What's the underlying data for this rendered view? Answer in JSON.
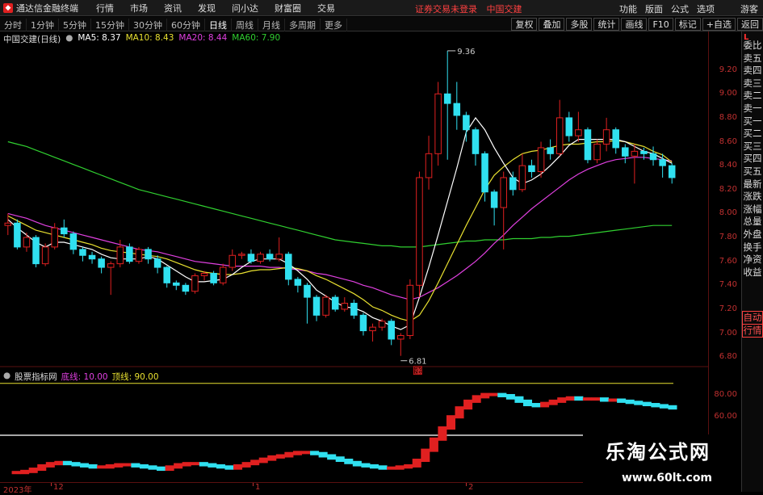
{
  "app": {
    "logo_text": "通达信金融终端",
    "menus": [
      "行情",
      "市场",
      "资讯",
      "发现",
      "问小达",
      "财富圈",
      "交易"
    ],
    "warning": "证券交易未登录",
    "stock_name": "中国交建",
    "right_menus": [
      "功能",
      "版面",
      "公式",
      "选项",
      "游客"
    ]
  },
  "toolbar": {
    "periods": [
      "分时",
      "1分钟",
      "5分钟",
      "15分钟",
      "30分钟",
      "60分钟",
      "日线",
      "周线",
      "月线",
      "多周期",
      "更多"
    ],
    "active_period": "日线",
    "buttons": [
      "复权",
      "叠加",
      "多股",
      "统计",
      "画线",
      "F10",
      "标记",
      "+自选",
      "返回"
    ]
  },
  "main_header": {
    "title": "中国交建(日线)",
    "ma5": "MA5: 8.37",
    "ma10": "MA10: 8.43",
    "ma20": "MA20: 8.44",
    "ma60": "MA60: 7.90",
    "colors": {
      "ma5": "#ffffff",
      "ma10": "#e8e030",
      "ma20": "#e040e0",
      "ma60": "#30d030"
    }
  },
  "sub_header": {
    "title": "股票指标网",
    "line1": "底线: 10.00",
    "line2": "顶线: 90.00",
    "colors": {
      "line1": "#e040e0",
      "line2": "#e8e030"
    }
  },
  "side_panel": {
    "corner": "L",
    "items": [
      "委比",
      "卖五",
      "卖四",
      "卖三",
      "卖二",
      "卖一",
      "买一",
      "买二",
      "买三",
      "买四",
      "买五",
      "最新",
      "涨跌",
      "涨幅",
      "总量",
      "外盘",
      "换手",
      "净资",
      "收益"
    ],
    "boxed_items": [
      "自动",
      "行情"
    ]
  },
  "chart_data": [
    {
      "type": "candlestick",
      "title": "中国交建(日线)",
      "ylim": [
        6.7,
        9.4
      ],
      "yticks": [
        "9.20",
        "9.00",
        "8.80",
        "8.60",
        "8.40",
        "8.20",
        "8.00",
        "7.80",
        "7.60",
        "7.40",
        "7.20",
        "7.00",
        "6.80"
      ],
      "annotations": {
        "high": "9.36",
        "low": "6.81",
        "marker": "涨"
      },
      "colors": {
        "up": "#e02020",
        "down": "#30e0f0"
      },
      "candles": [
        [
          7.9,
          7.92,
          8.0,
          7.82
        ],
        [
          7.92,
          7.72,
          7.95,
          7.7
        ],
        [
          7.72,
          7.8,
          7.84,
          7.68
        ],
        [
          7.8,
          7.58,
          7.82,
          7.55
        ],
        [
          7.58,
          7.72,
          7.75,
          7.56
        ],
        [
          7.72,
          7.88,
          7.92,
          7.7
        ],
        [
          7.88,
          7.83,
          7.95,
          7.8
        ],
        [
          7.83,
          7.7,
          7.85,
          7.66
        ],
        [
          7.7,
          7.65,
          7.72,
          7.6
        ],
        [
          7.65,
          7.62,
          7.68,
          7.58
        ],
        [
          7.62,
          7.55,
          7.64,
          7.5
        ],
        [
          7.55,
          7.58,
          7.6,
          7.32
        ],
        [
          7.58,
          7.72,
          7.78,
          7.55
        ],
        [
          7.72,
          7.6,
          7.75,
          7.58
        ],
        [
          7.6,
          7.7,
          7.72,
          7.58
        ],
        [
          7.7,
          7.62,
          7.72,
          7.58
        ],
        [
          7.62,
          7.55,
          7.65,
          7.5
        ],
        [
          7.55,
          7.42,
          7.56,
          7.38
        ],
        [
          7.42,
          7.4,
          7.44,
          7.36
        ],
        [
          7.4,
          7.35,
          7.42,
          7.32
        ],
        [
          7.35,
          7.48,
          7.5,
          7.33
        ],
        [
          7.48,
          7.5,
          7.52,
          7.44
        ],
        [
          7.5,
          7.42,
          7.52,
          7.4
        ],
        [
          7.42,
          7.55,
          7.58,
          7.4
        ],
        [
          7.55,
          7.65,
          7.7,
          7.52
        ],
        [
          7.65,
          7.66,
          7.68,
          7.62
        ],
        [
          7.66,
          7.6,
          7.7,
          7.58
        ],
        [
          7.6,
          7.66,
          7.68,
          7.58
        ],
        [
          7.66,
          7.62,
          7.7,
          7.6
        ],
        [
          7.62,
          7.66,
          7.8,
          7.6
        ],
        [
          7.66,
          7.45,
          7.68,
          7.4
        ],
        [
          7.45,
          7.4,
          7.47,
          7.34
        ],
        [
          7.4,
          7.3,
          7.42,
          7.08
        ],
        [
          7.3,
          7.15,
          7.32,
          7.1
        ],
        [
          7.15,
          7.3,
          7.32,
          7.13
        ],
        [
          7.3,
          7.2,
          7.32,
          7.18
        ],
        [
          7.2,
          7.25,
          7.3,
          7.18
        ],
        [
          7.25,
          7.15,
          7.28,
          7.12
        ],
        [
          7.15,
          7.02,
          7.17,
          6.98
        ],
        [
          7.02,
          7.05,
          7.08,
          6.93
        ],
        [
          7.05,
          7.1,
          7.12,
          7.02
        ],
        [
          7.1,
          6.95,
          7.12,
          6.9
        ],
        [
          6.95,
          6.98,
          7.0,
          6.81
        ],
        [
          6.98,
          7.4,
          7.45,
          6.95
        ],
        [
          7.4,
          8.3,
          8.35,
          7.3
        ],
        [
          8.3,
          8.5,
          8.65,
          8.2
        ],
        [
          8.5,
          9.0,
          9.1,
          8.4
        ],
        [
          9.0,
          8.92,
          9.36,
          8.45
        ],
        [
          8.92,
          8.82,
          9.1,
          8.7
        ],
        [
          8.82,
          8.7,
          8.85,
          8.6
        ],
        [
          8.7,
          8.5,
          8.72,
          8.4
        ],
        [
          8.5,
          8.18,
          8.52,
          8.1
        ],
        [
          8.18,
          8.05,
          8.2,
          7.9
        ],
        [
          8.05,
          8.3,
          8.35,
          7.7
        ],
        [
          8.3,
          8.2,
          8.35,
          8.15
        ],
        [
          8.2,
          8.4,
          8.5,
          8.18
        ],
        [
          8.4,
          8.35,
          8.45,
          8.3
        ],
        [
          8.35,
          8.55,
          8.6,
          8.3
        ],
        [
          8.55,
          8.5,
          8.62,
          8.45
        ],
        [
          8.5,
          8.8,
          8.95,
          8.48
        ],
        [
          8.8,
          8.65,
          8.85,
          8.6
        ],
        [
          8.65,
          8.7,
          8.85,
          8.6
        ],
        [
          8.7,
          8.45,
          8.72,
          8.42
        ],
        [
          8.45,
          8.58,
          8.62,
          8.42
        ],
        [
          8.58,
          8.7,
          8.8,
          8.52
        ],
        [
          8.7,
          8.55,
          8.72,
          8.5
        ],
        [
          8.55,
          8.48,
          8.58,
          8.42
        ],
        [
          8.48,
          8.52,
          8.58,
          8.25
        ],
        [
          8.52,
          8.5,
          8.55,
          8.45
        ],
        [
          8.5,
          8.45,
          8.56,
          8.4
        ],
        [
          8.45,
          8.4,
          8.5,
          8.3
        ],
        [
          8.4,
          8.3,
          8.42,
          8.25
        ]
      ],
      "ma5": [
        7.95,
        7.88,
        7.82,
        7.76,
        7.72,
        7.76,
        7.76,
        7.74,
        7.72,
        7.7,
        7.66,
        7.63,
        7.62,
        7.62,
        7.62,
        7.64,
        7.62,
        7.57,
        7.52,
        7.47,
        7.43,
        7.43,
        7.44,
        7.45,
        7.49,
        7.55,
        7.6,
        7.62,
        7.62,
        7.62,
        7.58,
        7.52,
        7.45,
        7.36,
        7.31,
        7.26,
        7.22,
        7.21,
        7.18,
        7.13,
        7.1,
        7.06,
        7.03,
        7.07,
        7.3,
        7.55,
        7.82,
        8.1,
        8.38,
        8.68,
        8.8,
        8.7,
        8.55,
        8.42,
        8.3,
        8.25,
        8.28,
        8.33,
        8.4,
        8.48,
        8.57,
        8.62,
        8.62,
        8.62,
        8.62,
        8.62,
        8.6,
        8.56,
        8.52,
        8.5,
        8.46,
        8.42
      ],
      "ma10": [
        7.98,
        7.94,
        7.9,
        7.86,
        7.84,
        7.82,
        7.8,
        7.78,
        7.76,
        7.74,
        7.71,
        7.69,
        7.68,
        7.67,
        7.66,
        7.65,
        7.64,
        7.62,
        7.59,
        7.56,
        7.53,
        7.51,
        7.5,
        7.49,
        7.49,
        7.5,
        7.52,
        7.53,
        7.53,
        7.54,
        7.55,
        7.54,
        7.52,
        7.48,
        7.45,
        7.41,
        7.37,
        7.33,
        7.28,
        7.22,
        7.19,
        7.15,
        7.12,
        7.1,
        7.15,
        7.27,
        7.42,
        7.58,
        7.74,
        7.9,
        8.05,
        8.2,
        8.32,
        8.39,
        8.45,
        8.5,
        8.52,
        8.53,
        8.55,
        8.57,
        8.58,
        8.58,
        8.59,
        8.6,
        8.6,
        8.61,
        8.6,
        8.58,
        8.56,
        8.52,
        8.49,
        8.43
      ],
      "ma20": [
        8.0,
        7.98,
        7.96,
        7.93,
        7.9,
        7.88,
        7.86,
        7.84,
        7.82,
        7.8,
        7.78,
        7.76,
        7.74,
        7.72,
        7.7,
        7.69,
        7.68,
        7.66,
        7.64,
        7.62,
        7.6,
        7.59,
        7.58,
        7.57,
        7.56,
        7.56,
        7.56,
        7.56,
        7.55,
        7.55,
        7.54,
        7.53,
        7.52,
        7.5,
        7.49,
        7.47,
        7.45,
        7.43,
        7.4,
        7.38,
        7.35,
        7.32,
        7.3,
        7.28,
        7.3,
        7.34,
        7.38,
        7.43,
        7.48,
        7.54,
        7.6,
        7.67,
        7.75,
        7.82,
        7.9,
        7.97,
        8.04,
        8.1,
        8.16,
        8.22,
        8.28,
        8.33,
        8.37,
        8.4,
        8.43,
        8.45,
        8.46,
        8.47,
        8.47,
        8.46,
        8.45,
        8.44
      ],
      "ma60": [
        8.6,
        8.58,
        8.56,
        8.53,
        8.5,
        8.47,
        8.44,
        8.41,
        8.38,
        8.35,
        8.32,
        8.29,
        8.26,
        8.23,
        8.2,
        8.18,
        8.16,
        8.14,
        8.12,
        8.1,
        8.08,
        8.06,
        8.04,
        8.02,
        8.0,
        7.98,
        7.96,
        7.94,
        7.92,
        7.9,
        7.88,
        7.86,
        7.84,
        7.82,
        7.8,
        7.78,
        7.77,
        7.76,
        7.75,
        7.74,
        7.73,
        7.73,
        7.72,
        7.72,
        7.72,
        7.73,
        7.74,
        7.75,
        7.76,
        7.77,
        7.77,
        7.78,
        7.78,
        7.78,
        7.79,
        7.79,
        7.79,
        7.8,
        7.8,
        7.81,
        7.81,
        7.82,
        7.83,
        7.84,
        7.85,
        7.86,
        7.87,
        7.88,
        7.89,
        7.9,
        7.9,
        7.9
      ]
    },
    {
      "type": "indicator",
      "title": "股票指标网",
      "ylim": [
        0,
        100
      ],
      "yticks": [
        "80.00",
        "60.00"
      ],
      "bottom_line": 10,
      "top_line": 90,
      "series_up_color": "#e02020",
      "series_down_color": "#30e0f0",
      "values": [
        10,
        10,
        11,
        13,
        16,
        18,
        19,
        18,
        17,
        16,
        15,
        15,
        16,
        17,
        17,
        16,
        15,
        14,
        13,
        15,
        17,
        18,
        18,
        17,
        16,
        15,
        14,
        16,
        18,
        20,
        22,
        24,
        25,
        27,
        28,
        28,
        27,
        25,
        23,
        21,
        19,
        17,
        16,
        15,
        14,
        14,
        15,
        16,
        21,
        30,
        40,
        50,
        60,
        68,
        74,
        78,
        80,
        80,
        79,
        77,
        74,
        71,
        70,
        72,
        74,
        76,
        77,
        76,
        76,
        76,
        75,
        75,
        74,
        73,
        72,
        71,
        70,
        69,
        68
      ]
    }
  ],
  "xaxis": {
    "labels": [
      "2023年",
      "12",
      "1",
      "2"
    ]
  }
}
